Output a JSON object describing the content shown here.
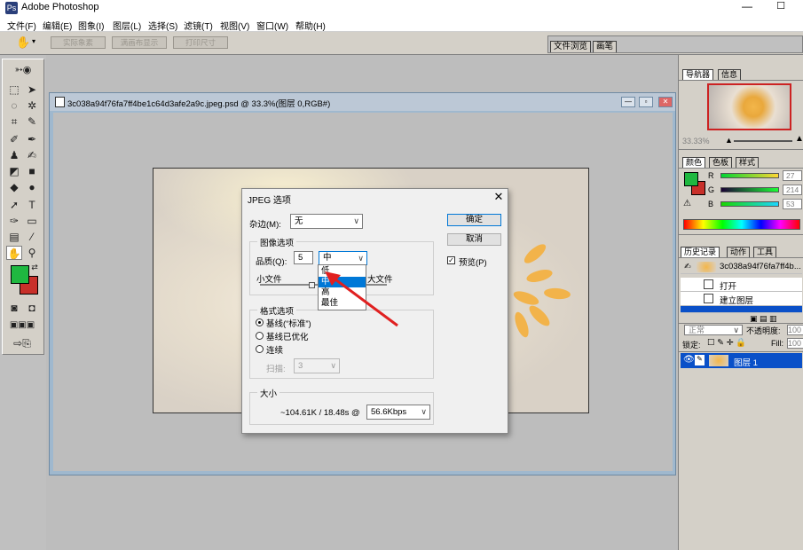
{
  "app": {
    "title": "Adobe Photoshop"
  },
  "menu": [
    "文件(F)",
    "编辑(E)",
    "图象(I)",
    "图层(L)",
    "选择(S)",
    "滤镜(T)",
    "视图(V)",
    "窗口(W)",
    "帮助(H)"
  ],
  "options_bar": {
    "buttons": [
      "实际象素",
      "满画布显示",
      "打印尺寸"
    ]
  },
  "palette_well": {
    "tabs": [
      "文件浏览",
      "画笔"
    ]
  },
  "document": {
    "title": "3c038a94f76fa7ff4be1c64d3afe2a9c.jpeg.psd @ 33.3%(图层 0,RGB#)"
  },
  "navigator": {
    "tabs": [
      "导航器",
      "信息"
    ],
    "zoom": "33.33%"
  },
  "color_panel": {
    "tabs": [
      "颜色",
      "色板",
      "样式"
    ],
    "channels": [
      {
        "label": "R",
        "value": "27"
      },
      {
        "label": "G",
        "value": "214"
      },
      {
        "label": "B",
        "value": "53"
      }
    ],
    "foreground": "#1fb840",
    "background": "#c8302a"
  },
  "history_panel": {
    "tabs": [
      "历史记录",
      "动作",
      "工具"
    ],
    "snapshot": "3c038a94f76fa7ff4b...",
    "items": [
      "打开",
      "建立图层"
    ]
  },
  "layers_panel": {
    "blend_mode": "正常",
    "opacity_label": "不透明度:",
    "opacity_value": "100",
    "lock_label": "锁定:",
    "fill_label": "Fill:",
    "fill_value": "100",
    "layer_name": "图层 1"
  },
  "dialog": {
    "title": "JPEG 选项",
    "matte_label": "杂边(M):",
    "matte_value": "无",
    "ok": "确定",
    "cancel": "取消",
    "preview_label": "预览(P)",
    "preview_checked": true,
    "image_options_title": "图像选项",
    "quality_label": "品质(Q):",
    "quality_value": "5",
    "quality_selected": "中",
    "quality_options": [
      "低",
      "中",
      "高",
      "最佳"
    ],
    "small_file": "小文件",
    "large_file": "大文件",
    "format_title": "格式选项",
    "format_options": [
      "基线(“标准”)",
      "基线已优化",
      "连续"
    ],
    "format_selected": 0,
    "scans_label": "扫描:",
    "scans_value": "3",
    "size_title": "大小",
    "size_text": "~104.61K / 18.48s @",
    "speed": "56.6Kbps"
  }
}
